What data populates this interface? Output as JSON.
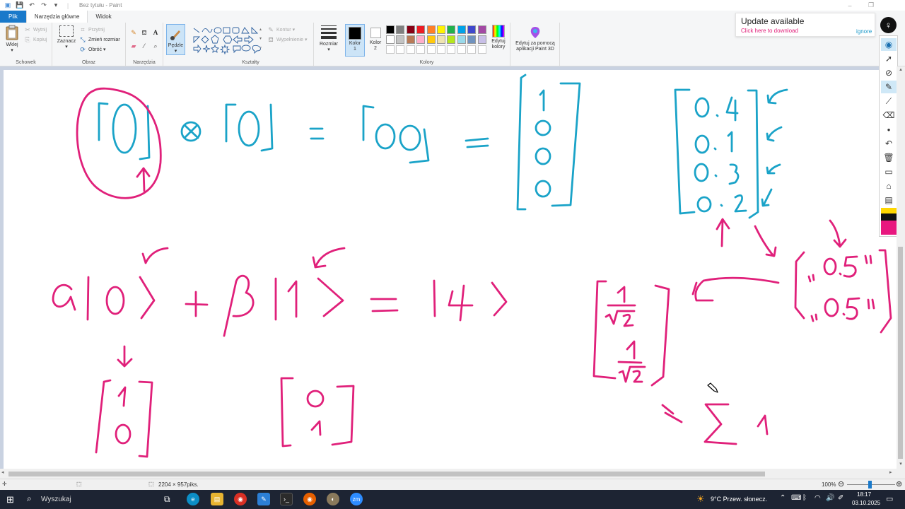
{
  "window": {
    "title": "Bez tytułu - Paint",
    "minimize": "–",
    "maximize": "❐"
  },
  "menu": {
    "file": "Plik",
    "tabs": [
      "Narzędzia główne",
      "Widok"
    ]
  },
  "ribbon": {
    "clipboard": {
      "label": "Schowek",
      "paste": "Wklej",
      "cut": "Wytnij",
      "copy": "Kopiuj"
    },
    "image": {
      "label": "Obraz",
      "select": "Zaznacz",
      "crop": "Przytnij",
      "resize": "Zmień rozmiar",
      "rotate": "Obróć ▾"
    },
    "tools": {
      "label": "Narzędzia"
    },
    "brushes": {
      "label": "Pędzle"
    },
    "shapes": {
      "label": "Kształty",
      "outline": "Kontur ▾",
      "fill": "Wypełnienie ▾"
    },
    "size": {
      "label": "Rozmiar"
    },
    "colors": {
      "label": "Kolory",
      "color1": "Kolor 1",
      "color2": "Kolor 2",
      "edit": "Edytuj kolory",
      "paint3d": "Edytuj za pomocą aplikacji Paint 3D",
      "color1_value": "#000000",
      "color2_value": "#ffffff",
      "palette_row1": [
        "#000000",
        "#7f7f7f",
        "#880015",
        "#ed1c24",
        "#ff7f27",
        "#fff200",
        "#22b14c",
        "#00a2e8",
        "#3f48cc",
        "#a349a4"
      ],
      "palette_row2": [
        "#ffffff",
        "#c3c3c3",
        "#b97a57",
        "#ffaec9",
        "#ffc90e",
        "#efe4b0",
        "#b5e61d",
        "#99d9ea",
        "#7092be",
        "#c8bfe7"
      ]
    }
  },
  "update": {
    "title": "Update available",
    "link": "Click here to download",
    "ignore": "ignore"
  },
  "status": {
    "size": "2204 × 957piks.",
    "zoom": "100%"
  },
  "taskbar": {
    "search": "Wyszukaj",
    "weather": "9°C  Przew. słonecz.",
    "time": "18:17",
    "date": "03.10.2025",
    "zoom_app": "zm"
  },
  "drawing": {
    "blue": "#1aa3c8",
    "pink": "#e0207a"
  }
}
